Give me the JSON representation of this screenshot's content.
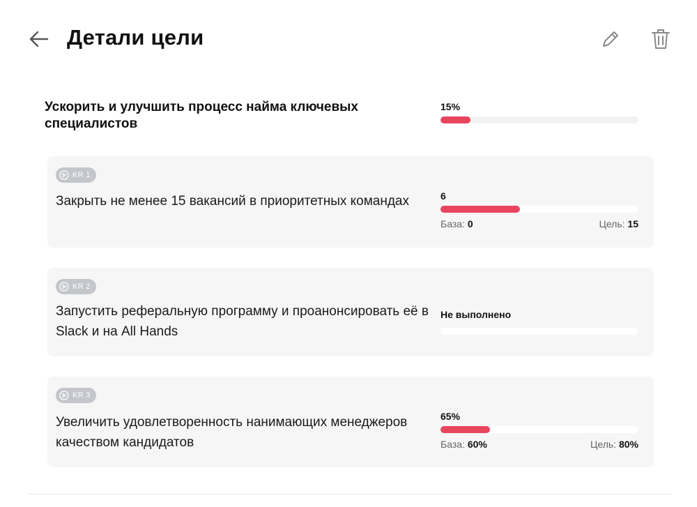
{
  "header": {
    "title": "Детали цели",
    "back_icon": "arrow-left-icon",
    "edit_icon": "pencil-icon",
    "delete_icon": "trash-icon"
  },
  "objective": {
    "title": "Ускорить и улучшить процесс найма ключевых специалистов",
    "progress_label": "15%",
    "progress": 0.15
  },
  "key_results": [
    {
      "badge": "KR 1",
      "title": "Закрыть не менее 15 вакансий в приоритетных командах",
      "value_label": "6",
      "progress": 0.4,
      "base_label": "База:",
      "base_value": "0",
      "target_label": "Цель:",
      "target_value": "15"
    },
    {
      "badge": "KR 2",
      "title": "Запустить реферальную программу и проанонсировать её в Slack и на All Hands",
      "status": "Не выполнено",
      "progress": 0
    },
    {
      "badge": "KR 3",
      "title": "Увеличить удовлетворенность нанимающих менеджеров качеством кандидатов",
      "value_label": "65%",
      "progress": 0.25,
      "base_label": "База:",
      "base_value": "60%",
      "target_label": "Цель:",
      "target_value": "80%"
    }
  ],
  "colors": {
    "accent": "#e8455f",
    "card_bg": "#f6f6f7",
    "badge_bg": "#c4c6cc"
  }
}
